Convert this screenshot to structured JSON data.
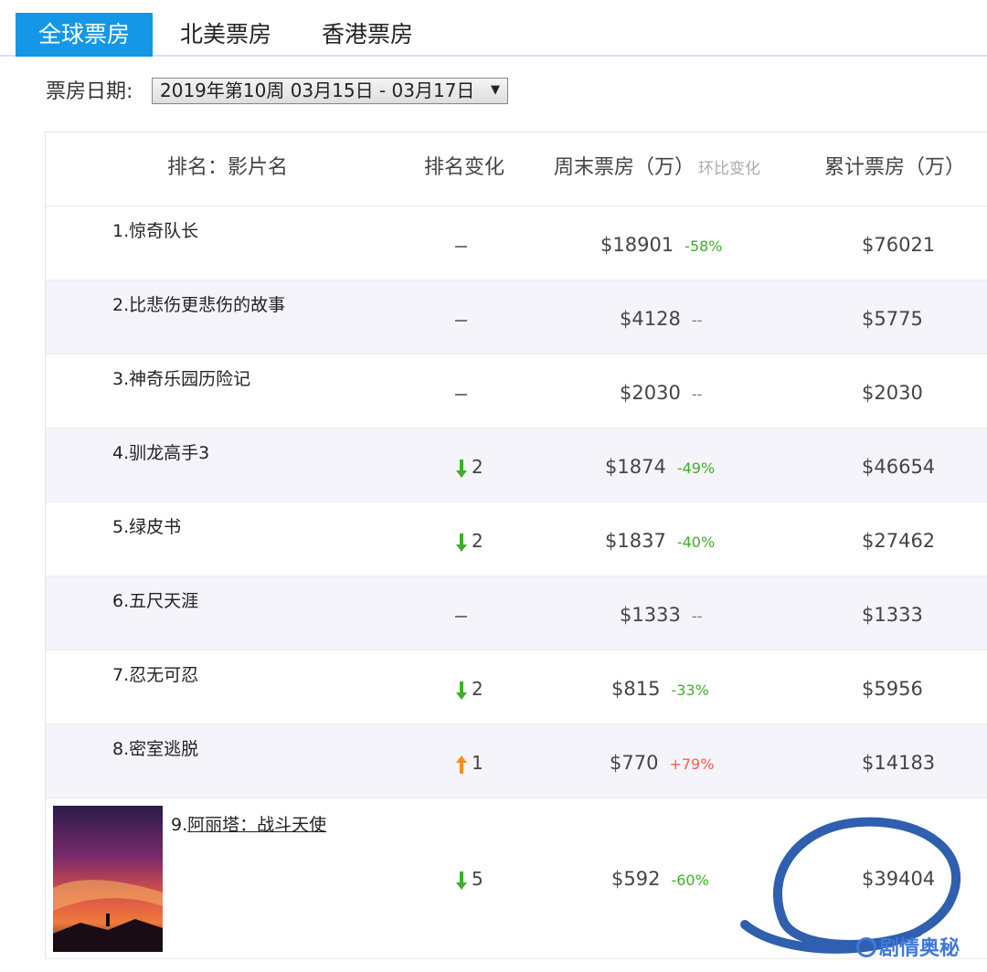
{
  "tabs": [
    {
      "label": "全球票房",
      "active": true
    },
    {
      "label": "北美票房",
      "active": false
    },
    {
      "label": "香港票房",
      "active": false
    }
  ],
  "date": {
    "label": "票房日期:",
    "selected": "2019年第10周 03月15日 - 03月17日"
  },
  "table": {
    "headers": {
      "name": "排名：影片名",
      "rank_change": "排名变化",
      "weekend": "周末票房（万）",
      "weekend_hint": "环比变化",
      "total": "累计票房（万）"
    },
    "rows": [
      {
        "num": "1.",
        "title": "惊奇队长",
        "rank_dir": "same",
        "rank_change": "",
        "weekend": "$18901",
        "pct": "-58%",
        "pct_dir": "down",
        "total": "$76021"
      },
      {
        "num": "2.",
        "title": "比悲伤更悲伤的故事",
        "rank_dir": "same",
        "rank_change": "",
        "weekend": "$4128",
        "pct": "--",
        "pct_dir": "flat",
        "total": "$5775"
      },
      {
        "num": "3.",
        "title": "神奇乐园历险记",
        "rank_dir": "same",
        "rank_change": "",
        "weekend": "$2030",
        "pct": "--",
        "pct_dir": "flat",
        "total": "$2030"
      },
      {
        "num": "4.",
        "title": "驯龙高手3",
        "rank_dir": "down",
        "rank_change": "2",
        "weekend": "$1874",
        "pct": "-49%",
        "pct_dir": "down",
        "total": "$46654"
      },
      {
        "num": "5.",
        "title": "绿皮书",
        "rank_dir": "down",
        "rank_change": "2",
        "weekend": "$1837",
        "pct": "-40%",
        "pct_dir": "down",
        "total": "$27462"
      },
      {
        "num": "6.",
        "title": "五尺天涯",
        "rank_dir": "same",
        "rank_change": "",
        "weekend": "$1333",
        "pct": "--",
        "pct_dir": "flat",
        "total": "$1333"
      },
      {
        "num": "7.",
        "title": "忍无可忍",
        "rank_dir": "down",
        "rank_change": "2",
        "weekend": "$815",
        "pct": "-33%",
        "pct_dir": "down",
        "total": "$5956"
      },
      {
        "num": "8.",
        "title": "密室逃脱",
        "rank_dir": "up",
        "rank_change": "1",
        "weekend": "$770",
        "pct": "+79%",
        "pct_dir": "up",
        "total": "$14183"
      },
      {
        "num": "9.",
        "title": "阿丽塔：战斗天使",
        "rank_dir": "down",
        "rank_change": "5",
        "weekend": "$592",
        "pct": "-60%",
        "pct_dir": "down",
        "total": "$39404"
      }
    ]
  },
  "watermark": "剧情奥秘",
  "colors": {
    "tab_active": "#1597e5",
    "pct_down": "#3fae2a",
    "pct_up": "#ff5a4a",
    "arrow_down": "#3fae2a",
    "arrow_up": "#f0901a",
    "annotation": "#2f5fae"
  }
}
